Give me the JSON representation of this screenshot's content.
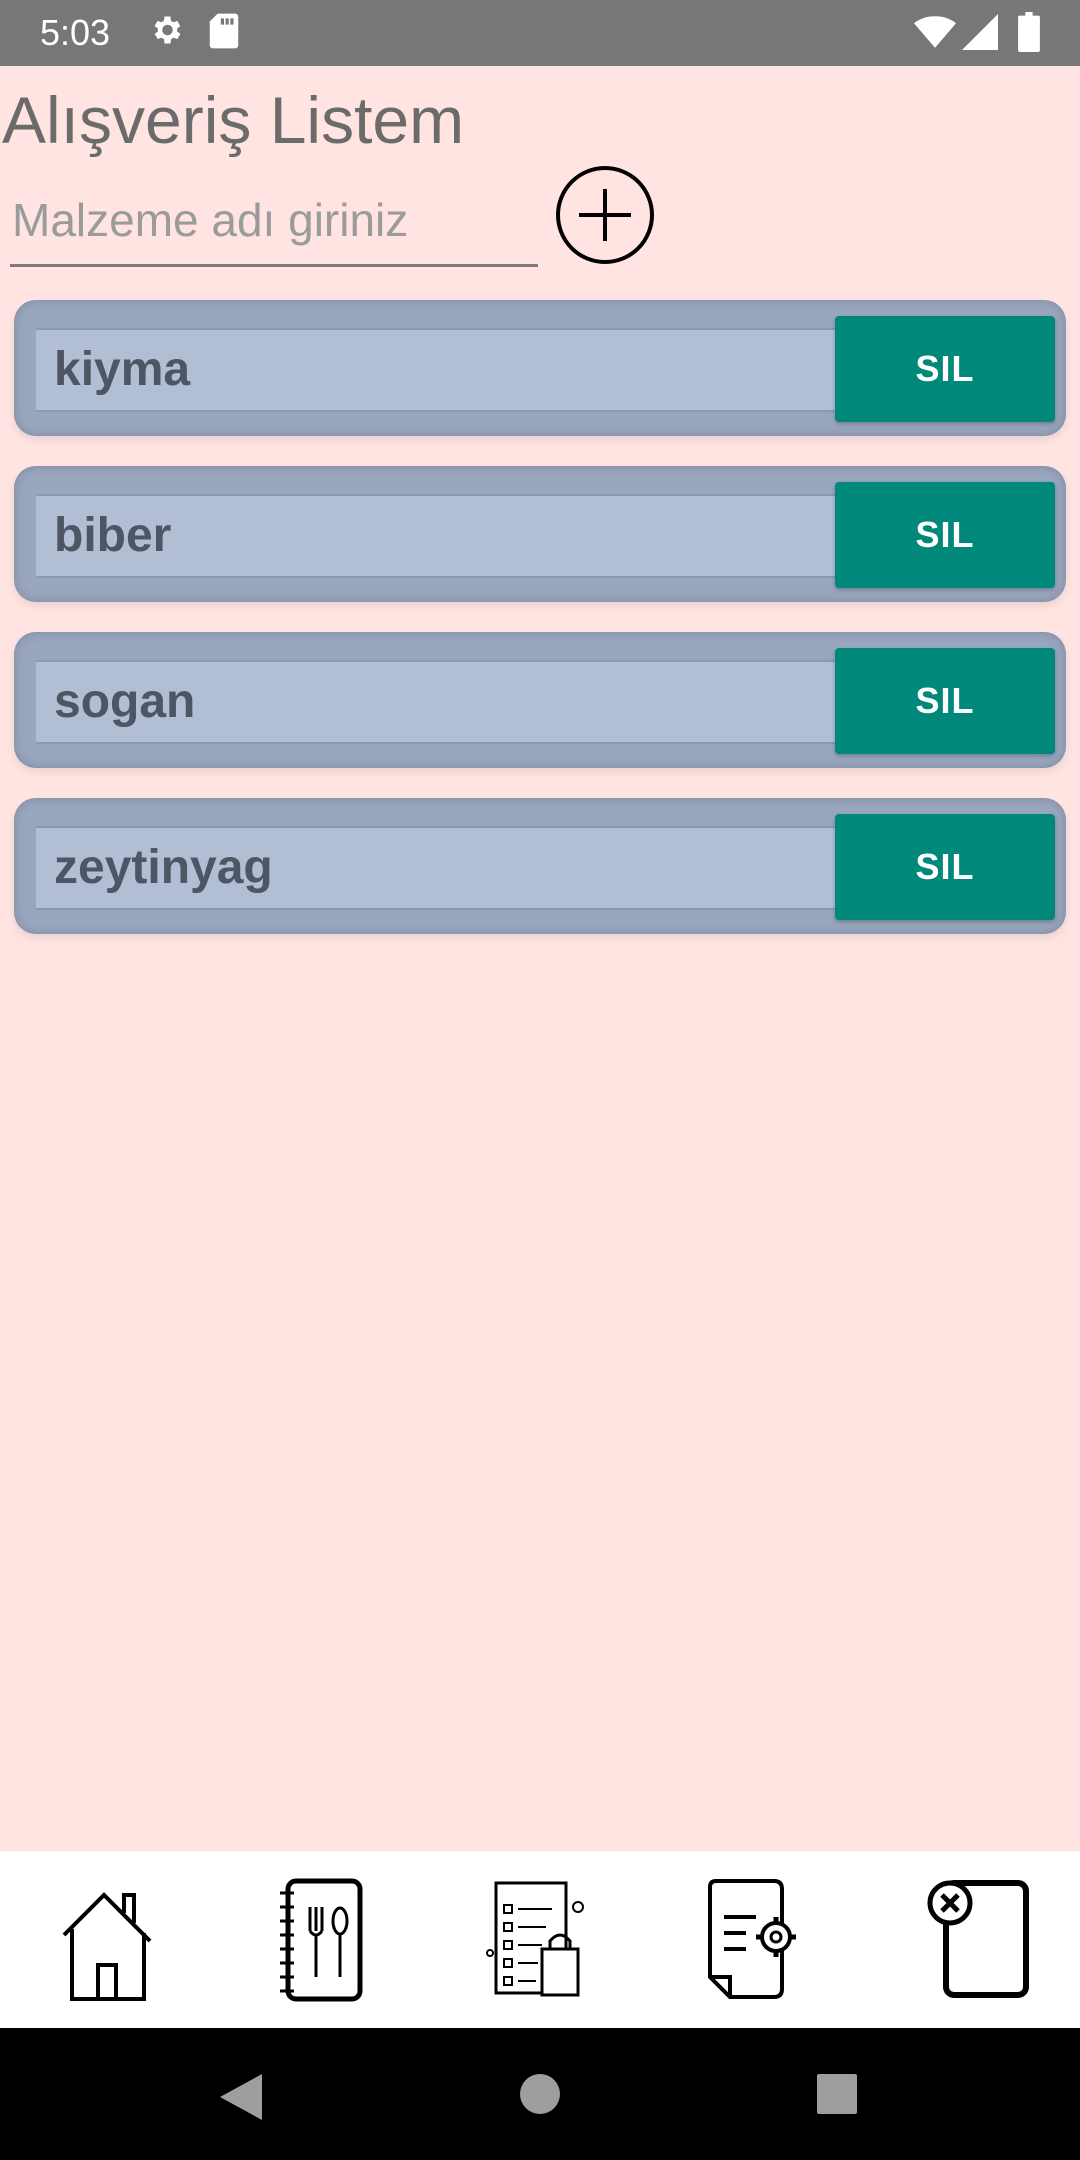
{
  "status_bar": {
    "time": "5:03",
    "icons": [
      "gear-icon",
      "sd-card-icon",
      "wifi-icon",
      "signal-icon",
      "battery-icon"
    ]
  },
  "page": {
    "title": "Alışveriş Listem",
    "input_placeholder": "Malzeme adı giriniz",
    "input_value": "",
    "add_icon": "plus-circle-icon"
  },
  "items": [
    {
      "name": "kiyma",
      "delete_label": "SIL"
    },
    {
      "name": "biber",
      "delete_label": "SIL"
    },
    {
      "name": "sogan",
      "delete_label": "SIL"
    },
    {
      "name": "zeytinyag",
      "delete_label": "SIL"
    }
  ],
  "bottom_nav": [
    "home-icon",
    "recipe-book-icon",
    "shopping-list-icon",
    "document-settings-icon",
    "close-page-icon"
  ],
  "system_nav": [
    "back-icon",
    "home-circle-icon",
    "recents-icon"
  ],
  "colors": {
    "background": "#FFE4E1",
    "item_card": "#9AA6BD",
    "item_field": "#B2BED4",
    "delete_button": "#00897B",
    "status_bar": "#777777"
  }
}
